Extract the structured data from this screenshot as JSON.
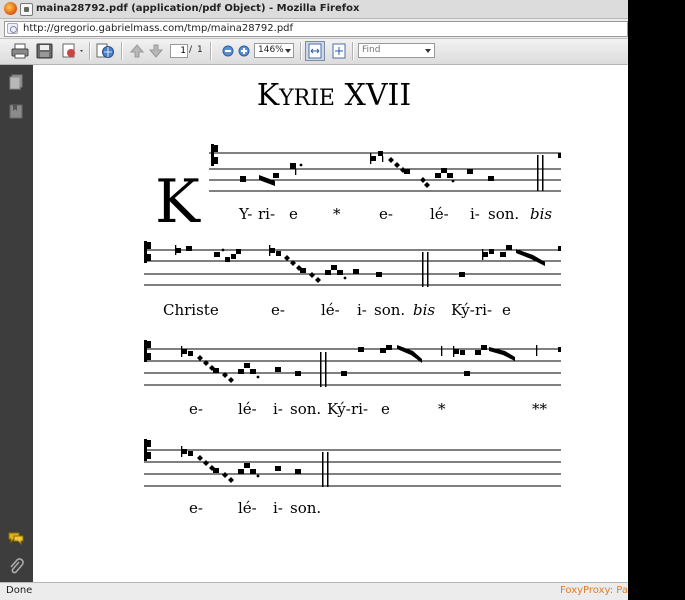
{
  "window": {
    "title": "maina28792.pdf (application/pdf Object) - Mozilla Firefox"
  },
  "navbar": {
    "url": "http://gregorio.gabrielmass.com/tmp/maina28792.pdf"
  },
  "pdf_toolbar": {
    "page_current": "1",
    "page_separator": "/",
    "page_total": "1",
    "zoom": "146%",
    "find_placeholder": "Find"
  },
  "document": {
    "title": "Kyrie XVII",
    "initial": "K",
    "lines": [
      {
        "syllables": [
          "Y-",
          "ri-",
          "e",
          "*",
          "e-",
          "lé-",
          "i-",
          "son."
        ],
        "marker": "bis"
      },
      {
        "syllables": [
          "Christe",
          "e-",
          "lé-",
          "i-",
          "son."
        ],
        "marker": "bis",
        "syllables_after": [
          "Ký-",
          "ri-",
          "e"
        ]
      },
      {
        "syllables": [
          "e-",
          "lé-",
          "i-",
          "son.",
          "Ký-",
          "ri-",
          "e",
          "*",
          "**"
        ]
      },
      {
        "syllables": [
          "e-",
          "lé-",
          "i-",
          "son."
        ]
      }
    ]
  },
  "status": {
    "text": "Done",
    "extension": "FoxyProxy: Patte"
  }
}
